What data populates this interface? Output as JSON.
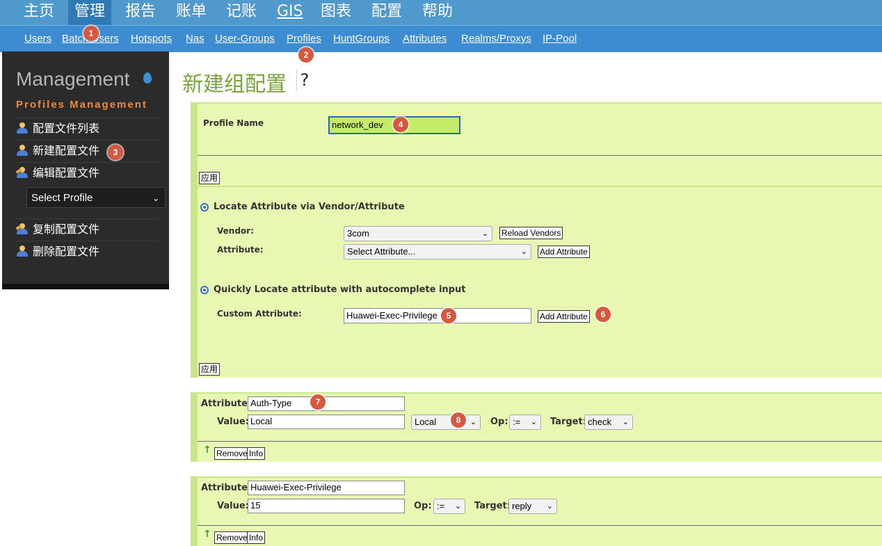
{
  "topnav": {
    "items": [
      "主页",
      "管理",
      "报告",
      "账单",
      "记账",
      "GIS",
      "图表",
      "配置",
      "帮助"
    ]
  },
  "subnav": {
    "items": [
      "Users",
      "Batch Users",
      "Hotspots",
      "Nas",
      "User-Groups",
      "Profiles",
      "HuntGroups",
      "Attributes",
      "Realms/Proxys",
      "IP-Pool"
    ]
  },
  "badges": [
    "1",
    "2",
    "3",
    "4",
    "5",
    "6",
    "7",
    "8"
  ],
  "sidebar": {
    "title": "Management",
    "subtitle": "Profiles Management",
    "links": [
      "配置文件列表",
      "新建配置文件",
      "编辑配置文件",
      "复制配置文件",
      "删除配置文件"
    ],
    "select_profile": "Select Profile"
  },
  "page": {
    "title": "新建组配置",
    "help": "?"
  },
  "profile_form": {
    "label": "Profile Name",
    "value": "network_dev",
    "apply": "应用"
  },
  "attr_form": {
    "locate_vendor": "Locate Attribute via Vendor/Attribute",
    "vendor_label": "Vendor:",
    "vendor_value": "3com",
    "reload_vendors": "Reload Vendors",
    "attribute_label": "Attribute:",
    "attribute_value": "Select Attribute...",
    "add_attribute": "Add Attribute",
    "quick_locate": "Quickly Locate attribute with autocomplete input",
    "custom_label": "Custom Attribute:",
    "custom_value": "Huawei-Exec-Privilege",
    "add_attribute2": "Add Attribute",
    "apply": "应用"
  },
  "attr_rows": [
    {
      "attribute_label": "Attribute:",
      "attribute": "Auth-Type",
      "value_label": "Value:",
      "value": "Local",
      "value_select": "Local",
      "op_label": "Op:",
      "op": ":=",
      "target_label": "Target:",
      "target": "check",
      "remove": "Remove",
      "info": "Info"
    },
    {
      "attribute_label": "Attribute:",
      "attribute": "Huawei-Exec-Privilege",
      "value_label": "Value:",
      "value": "15",
      "op_label": "Op:",
      "op": ":=",
      "target_label": "Target:",
      "target": "reply",
      "remove": "Remove",
      "info": "Info"
    }
  ]
}
